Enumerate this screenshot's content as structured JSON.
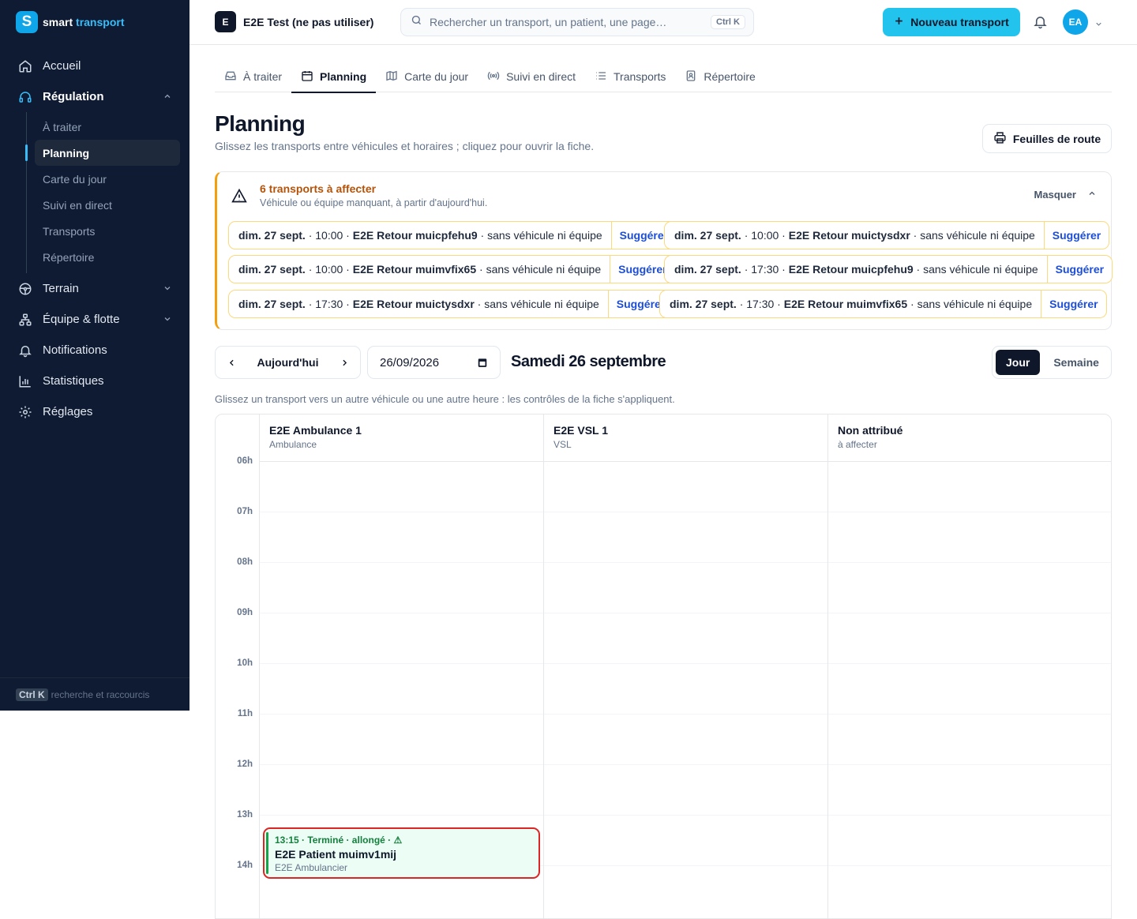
{
  "brand": {
    "name_a": "smart",
    "name_b": "transport",
    "logo_letter": "S",
    "accent": "#22c4ee"
  },
  "sidebar": {
    "items": [
      {
        "label": "Accueil",
        "icon": "home-icon"
      },
      {
        "label": "Régulation",
        "icon": "headset-icon"
      },
      {
        "label": "Terrain",
        "icon": "steering-icon"
      },
      {
        "label": "Équipe & flotte",
        "icon": "org-icon"
      },
      {
        "label": "Notifications",
        "icon": "bell-icon"
      },
      {
        "label": "Statistiques",
        "icon": "chart-icon"
      },
      {
        "label": "Réglages",
        "icon": "gear-icon"
      }
    ],
    "sub_items": [
      "À traiter",
      "Planning",
      "Carte du jour",
      "Suivi en direct",
      "Transports",
      "Répertoire"
    ],
    "footer_kbd": "Ctrl K",
    "footer_text": "recherche et raccourcis"
  },
  "topbar": {
    "org_badge": "E",
    "org_name": "E2E Test (ne pas utiliser)",
    "search_placeholder": "Rechercher un transport, un patient, une page…",
    "search_kbd": "Ctrl K",
    "new_button": "Nouveau transport",
    "avatar": "EA"
  },
  "tabs": [
    {
      "label": "À traiter",
      "icon": "inbox-icon"
    },
    {
      "label": "Planning",
      "icon": "calendar-icon"
    },
    {
      "label": "Carte du jour",
      "icon": "map-icon"
    },
    {
      "label": "Suivi en direct",
      "icon": "broadcast-icon"
    },
    {
      "label": "Transports",
      "icon": "list-icon"
    },
    {
      "label": "Répertoire",
      "icon": "contact-icon"
    }
  ],
  "page": {
    "title": "Planning",
    "subtitle": "Glissez les transports entre véhicules et horaires ; cliquez pour ouvrir la fiche.",
    "roadsheets_button": "Feuilles de route"
  },
  "alert": {
    "title": "6 transports à affecter",
    "subtitle": "Véhicule ou équipe manquant, à partir d'aujourd'hui.",
    "hide_label": "Masquer",
    "suggest_label": "Suggérer",
    "items": [
      {
        "date": "dim. 27 sept.",
        "time": " · 10:00 · ",
        "name": "E2E Retour muicpfehu9",
        "status": " · sans véhicule ni équipe"
      },
      {
        "date": "dim. 27 sept.",
        "time": " · 10:00 · ",
        "name": "E2E Retour muictysdxr",
        "status": " · sans véhicule ni équipe"
      },
      {
        "date": "dim. 27 sept.",
        "time": " · 10:00 · ",
        "name": "E2E Retour muimvfix65",
        "status": " · sans véhicule ni équipe"
      },
      {
        "date": "dim. 27 sept.",
        "time": " · 17:30 · ",
        "name": "E2E Retour muicpfehu9",
        "status": " · sans véhicule ni équipe"
      },
      {
        "date": "dim. 27 sept.",
        "time": " · 17:30 · ",
        "name": "E2E Retour muictysdxr",
        "status": " · sans véhicule ni équipe"
      },
      {
        "date": "dim. 27 sept.",
        "time": " · 17:30 · ",
        "name": "E2E Retour muimvfix65",
        "status": " · sans véhicule ni équipe"
      }
    ]
  },
  "controls": {
    "today": "Aujourd'hui",
    "date_value": "26/09/2026",
    "day_label": "Samedi 26 septembre",
    "view_day": "Jour",
    "view_week": "Semaine",
    "hint": "Glissez un transport vers un autre véhicule ou une autre heure : les contrôles de la fiche s'appliquent."
  },
  "planning": {
    "columns": [
      {
        "name": "E2E Ambulance 1",
        "sub": "Ambulance"
      },
      {
        "name": "E2E VSL 1",
        "sub": "VSL"
      },
      {
        "name": "Non attribué",
        "sub": "à affecter"
      }
    ],
    "hours": [
      "06h",
      "07h",
      "08h",
      "09h",
      "10h",
      "11h",
      "12h",
      "13h",
      "14h"
    ],
    "event": {
      "header": "13:15 · Terminé · allongé · ⚠",
      "patient": "E2E Patient muimv1mij",
      "crew": "E2E Ambulancier",
      "status_color": "#16a34a",
      "border_color": "#dc2626"
    }
  }
}
